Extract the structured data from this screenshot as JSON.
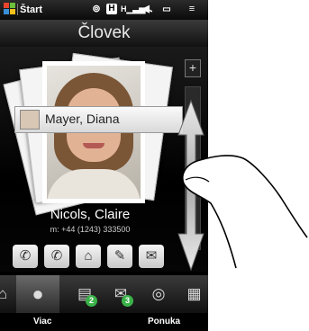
{
  "status_bar": {
    "start_label": "Štart",
    "icons": [
      "windows-flag-icon",
      "message-icon",
      "data-connection-icon",
      "signal-icon",
      "volume-icon",
      "battery-icon",
      "menu-icon"
    ]
  },
  "header": {
    "title": "Človek"
  },
  "people": {
    "selected_name": "Mayer, Diana",
    "contact_name": "Nicols, Claire",
    "contact_phone": "m: +44 (1243) 333500"
  },
  "actions": [
    "phone-icon",
    "mobile-phone-icon",
    "home-phone-icon",
    "sms-icon",
    "email-icon"
  ],
  "tabs": [
    {
      "icon": "home-icon",
      "selected": false
    },
    {
      "icon": "person-icon",
      "selected": true
    },
    {
      "icon": "messages-icon",
      "badge": "2",
      "selected": false
    },
    {
      "icon": "mail-icon",
      "badge": "3",
      "selected": false
    },
    {
      "icon": "internet-icon",
      "selected": false
    },
    {
      "icon": "calendar-icon",
      "selected": false
    }
  ],
  "softkeys": {
    "left": "Viac",
    "right": "Ponuka"
  },
  "colors": {
    "badge_green": "#3bb24a",
    "header_text": "#e8e8e8"
  }
}
